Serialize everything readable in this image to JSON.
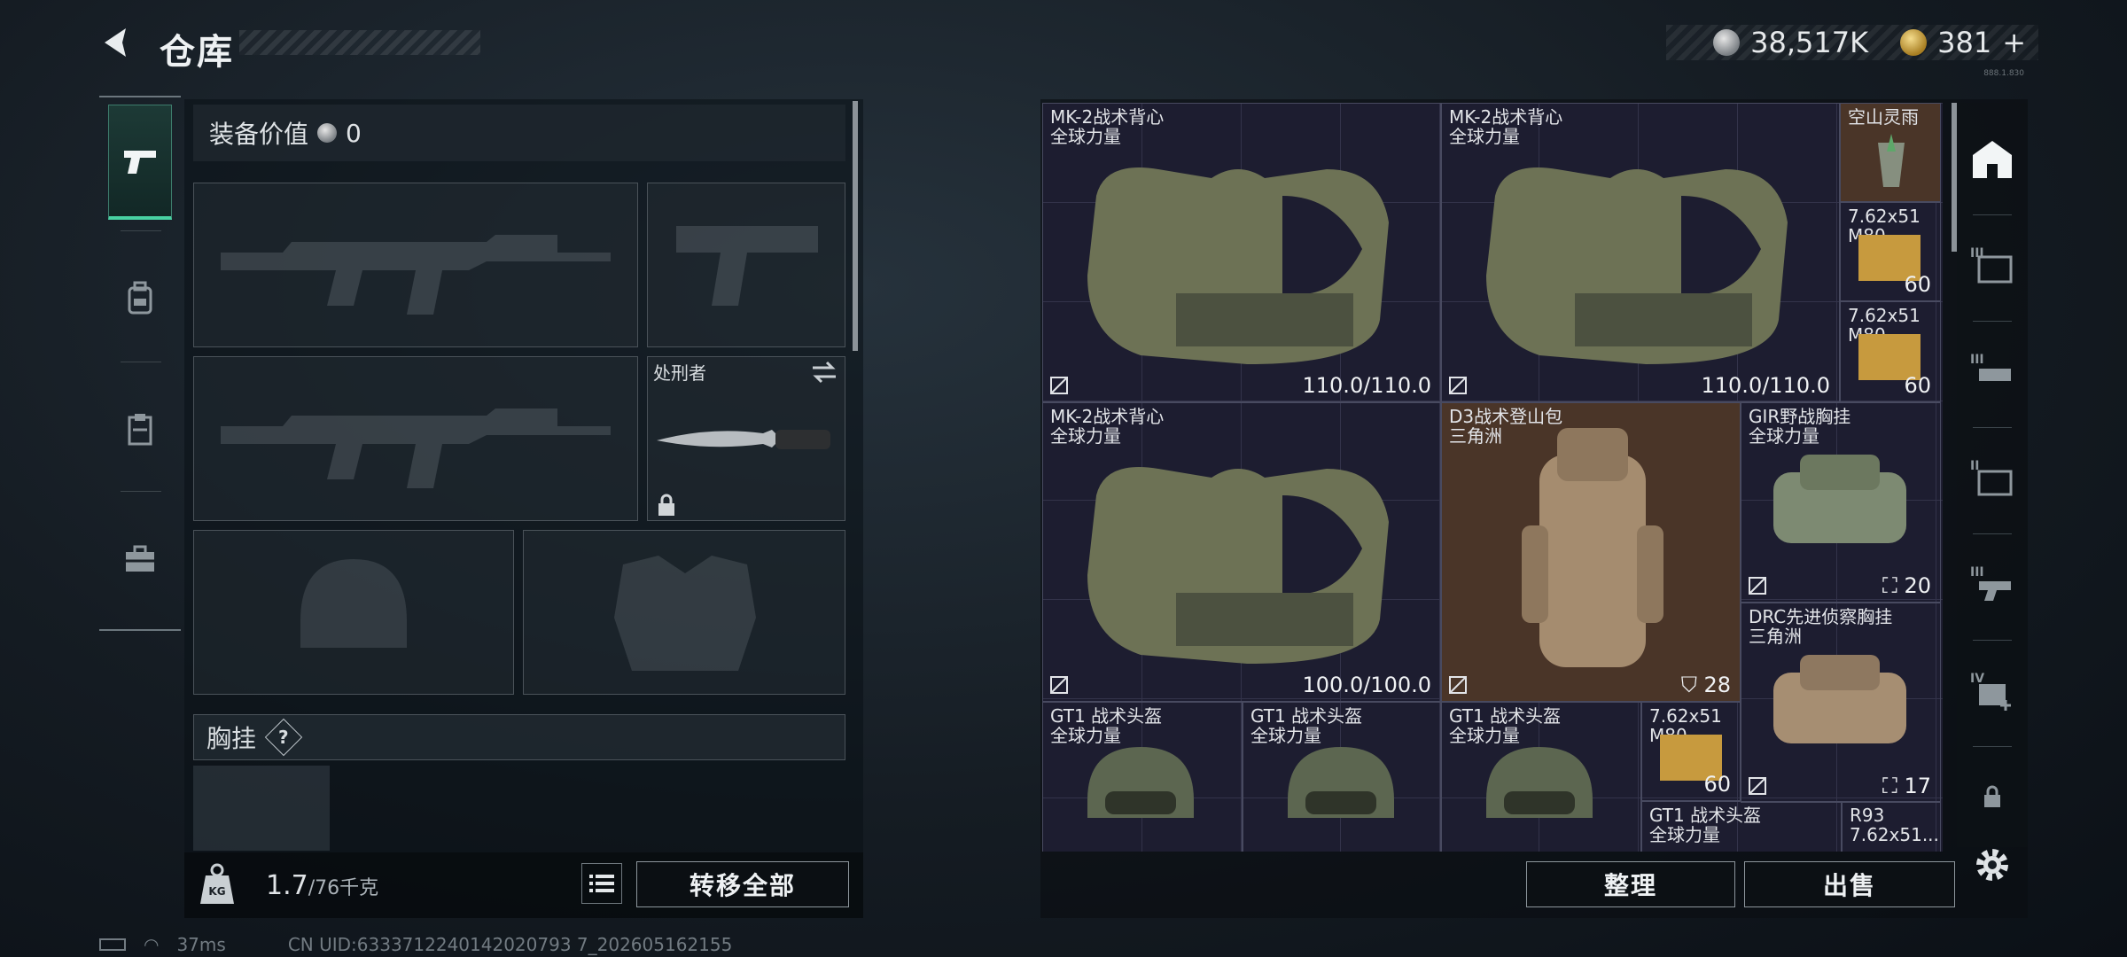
{
  "header": {
    "title": "仓库",
    "version": "888.1.830"
  },
  "currency": {
    "silver": "38,517K",
    "gold": "381",
    "add": "+"
  },
  "rail": {
    "items": [
      {
        "icon": "pistol-icon",
        "active": true
      },
      {
        "icon": "backpack-icon",
        "active": false
      },
      {
        "icon": "clipboard-icon",
        "active": false
      },
      {
        "icon": "toolbox-icon",
        "active": false
      }
    ]
  },
  "loadout": {
    "value_label": "装备价值",
    "value": "0",
    "melee_name": "处刑者",
    "vest_label": "胸挂",
    "help": "?"
  },
  "footer_left": {
    "weight": "1.7",
    "capacity": "/76千克",
    "transfer_all": "转移全部"
  },
  "stash_items": [
    {
      "name": "MK-2战术背心",
      "sub": "全球力量",
      "value": "110.0/110.0"
    },
    {
      "name": "MK-2战术背心",
      "sub": "全球力量",
      "value": "110.0/110.0"
    },
    {
      "name": "空山灵雨",
      "sub": "",
      "value": ""
    },
    {
      "name": "7.62x51",
      "sub": "M80",
      "value": "60"
    },
    {
      "name": "7.62x51",
      "sub": "M80",
      "value": "60"
    },
    {
      "name": "MK-2战术背心",
      "sub": "全球力量",
      "value": "100.0/100.0"
    },
    {
      "name": "D3战术登山包",
      "sub": "三角洲",
      "value": "28"
    },
    {
      "name": "GIR野战胸挂",
      "sub": "全球力量",
      "value": "20"
    },
    {
      "name": "DRC先进侦察胸挂",
      "sub": "三角洲",
      "value": "17"
    },
    {
      "name": "GT1 战术头盔",
      "sub": "全球力量",
      "value": ""
    },
    {
      "name": "GT1 战术头盔",
      "sub": "全球力量",
      "value": ""
    },
    {
      "name": "GT1 战术头盔",
      "sub": "全球力量",
      "value": ""
    },
    {
      "name": "7.62x51",
      "sub": "M80",
      "value": "60"
    },
    {
      "name": "GT1 战术头盔",
      "sub": "全球力量",
      "value": ""
    },
    {
      "name": "R93",
      "sub": "7.62x51...",
      "value": ""
    }
  ],
  "right_sidebar": {
    "tiers": [
      "",
      "III",
      "III",
      "II",
      "III",
      "IV",
      ""
    ]
  },
  "footer_right": {
    "sort": "整理",
    "sell": "出售"
  },
  "status": {
    "ping": "37ms",
    "uid": "CN UID:6333712240142020793 7_202605162155"
  },
  "colors": {
    "accent": "#48d1a2",
    "stash_bg": "#1d1d30",
    "backpack_cell": "#4a3528",
    "brown_cell": "#4a3528"
  }
}
